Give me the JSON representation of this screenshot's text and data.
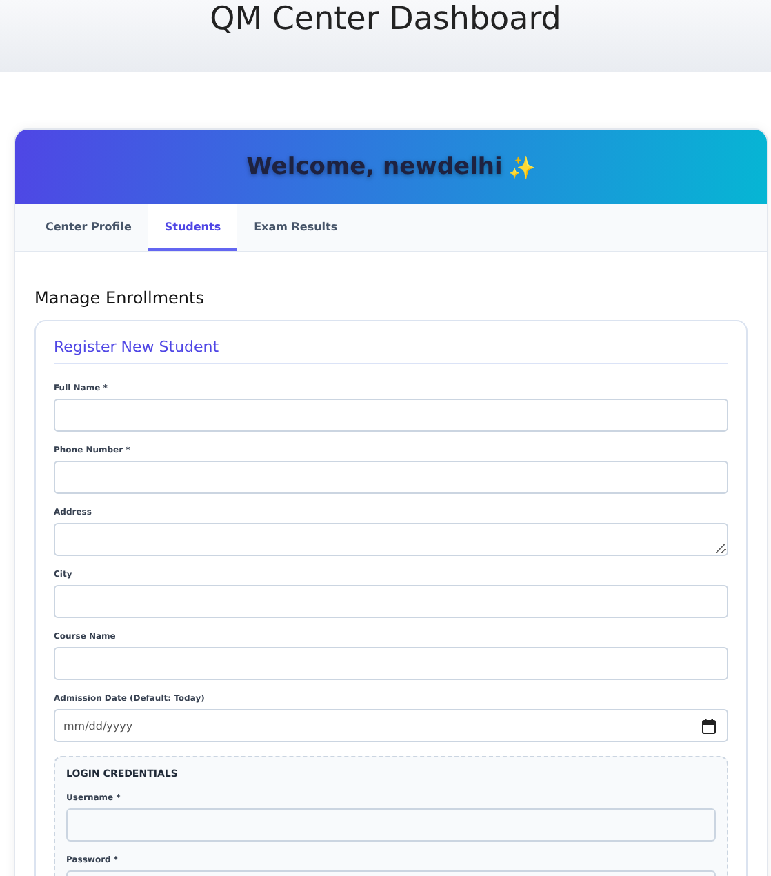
{
  "page_title": "QM Center Dashboard",
  "welcome": {
    "text": "Welcome, newdelhi",
    "emoji": "✨"
  },
  "tabs": [
    {
      "label": "Center Profile",
      "selected": false
    },
    {
      "label": "Students",
      "selected": true
    },
    {
      "label": "Exam Results",
      "selected": false
    }
  ],
  "section_title": "Manage Enrollments",
  "form": {
    "title": "Register New Student",
    "fields": [
      {
        "label": "Full Name *",
        "kind": "input"
      },
      {
        "label": "Phone Number *",
        "kind": "input"
      },
      {
        "label": "Address",
        "kind": "textarea"
      },
      {
        "label": "City",
        "kind": "input"
      },
      {
        "label": "Course Name",
        "kind": "input"
      },
      {
        "label": "Admission Date (Default: Today)",
        "kind": "date",
        "placeholder": "mm/dd/yyyy"
      }
    ],
    "credentials": {
      "title": "LOGIN CREDENTIALS",
      "fields": [
        {
          "label": "Username *",
          "kind": "input"
        },
        {
          "label": "Password *",
          "kind": "input"
        }
      ]
    }
  }
}
